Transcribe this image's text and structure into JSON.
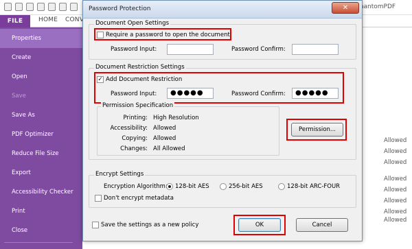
{
  "app": {
    "title": "t PhantomPDF",
    "ribbon_tabs": [
      {
        "label": "HOME"
      },
      {
        "label": "CONV"
      }
    ],
    "file_tab": "FILE"
  },
  "sidebar": {
    "items": [
      {
        "label": "Properties"
      },
      {
        "label": "Create"
      },
      {
        "label": "Open"
      },
      {
        "label": "Save"
      },
      {
        "label": "Save As"
      },
      {
        "label": "PDF Optimizer"
      },
      {
        "label": "Reduce File Size"
      },
      {
        "label": "Export"
      },
      {
        "label": "Accessibility Checker"
      },
      {
        "label": "Print"
      },
      {
        "label": "Close"
      }
    ]
  },
  "background_right": {
    "values": [
      "Allowed",
      "Allowed",
      "Allowed",
      "Allowed",
      "Allowed",
      "Allowed",
      "Allowed",
      "Allowed"
    ]
  },
  "dialog": {
    "title": "Password Protection",
    "close_label": "✕",
    "open_settings": {
      "legend": "Document Open Settings",
      "require_password_label": "Require a password to open the document",
      "require_password_checked": false,
      "password_input_label": "Password Input:",
      "password_input_value": "",
      "password_confirm_label": "Password Confirm:",
      "password_confirm_value": ""
    },
    "restriction_settings": {
      "legend": "Document Restriction Settings",
      "add_restriction_label": "Add Document Restriction",
      "add_restriction_checked": true,
      "check_mark": "✓",
      "password_input_label": "Password Input:",
      "password_input_value": "●●●●●",
      "password_confirm_label": "Password Confirm:",
      "password_confirm_value": "●●●●●"
    },
    "permission_spec": {
      "legend": "Permission Specification",
      "rows": [
        {
          "key": "Printing:",
          "value": "High Resolution"
        },
        {
          "key": "Accessibility:",
          "value": "Allowed"
        },
        {
          "key": "Copying:",
          "value": "Allowed"
        },
        {
          "key": "Changes:",
          "value": "All Allowed"
        }
      ],
      "permission_button": "Permission..."
    },
    "encrypt_settings": {
      "legend": "Encrypt Settings",
      "algorithm_label": "Encryption Algorithm:",
      "options": [
        {
          "label": "128-bit AES",
          "selected": true
        },
        {
          "label": "256-bit AES",
          "selected": false
        },
        {
          "label": "128-bit ARC-FOUR",
          "selected": false
        }
      ],
      "dont_encrypt_metadata_label": "Don't encrypt metadata",
      "dont_encrypt_metadata_checked": false
    },
    "save_policy_label": "Save the settings as a new policy",
    "save_policy_checked": false,
    "ok_label": "OK",
    "cancel_label": "Cancel"
  },
  "colors": {
    "sidebar_bg": "#7e4ba1",
    "sidebar_active": "#9a6ec0",
    "file_tab": "#7b3d9b",
    "highlight": "#e00000"
  }
}
